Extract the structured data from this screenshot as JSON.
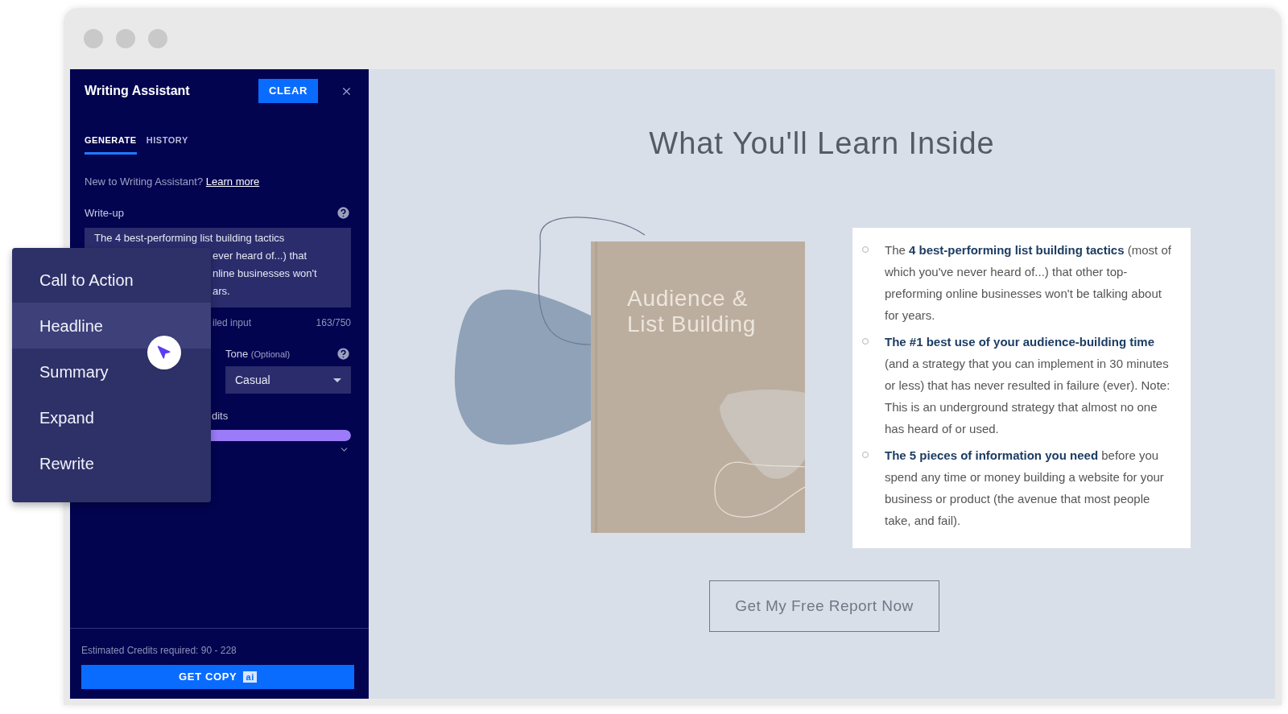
{
  "panel": {
    "title": "Writing Assistant",
    "clear_button": "CLEAR",
    "tabs": [
      {
        "label": "GENERATE",
        "selected": true
      },
      {
        "label": "HISTORY",
        "selected": false
      }
    ],
    "intro": "New to Writing Assistant?",
    "intro_link": "Learn more",
    "writeup_label": "Write-up",
    "writeup_lines": [
      "The 4 best-performing list building tactics",
      "ever heard of...) that",
      "nline businesses won't",
      "ars."
    ],
    "input_hint": "iled input",
    "char_count": "163/750",
    "tone_label": "Tone",
    "tone_hint": "(Optional)",
    "tone_value": "Casual",
    "credits_label": "dits",
    "credits_bar": {
      "level": 1
    },
    "estimate": "Estimated Credits required: 90 - 228",
    "get_copy": "GET COPY",
    "get_copy_badge": "ai"
  },
  "menu": {
    "items": [
      {
        "label": "Call to Action",
        "selected": false
      },
      {
        "label": "Headline",
        "selected": true
      },
      {
        "label": "Summary",
        "selected": false
      },
      {
        "label": "Expand",
        "selected": false
      },
      {
        "label": "Rewrite",
        "selected": false
      }
    ]
  },
  "page": {
    "title": "What You'll Learn Inside",
    "book_title_lines": [
      "Audience &",
      "List Building"
    ],
    "bullets": [
      "The **4 best-performing list building tactics** (most of which you've never heard of...) that other top-preforming online businesses won't be talking about for years.",
      "**The #1 best use of your audience-building time** (and a strategy that you can implement in 30 minutes or less) that has never resulted in failure (ever). Note: This is an underground strategy that almost no one has heard of or used.",
      "**The 5 pieces of information you need** before you spend any time or money building a website for your business or product (the avenue that most people take, and fail)."
    ],
    "cta": "Get My Free Report Now"
  }
}
